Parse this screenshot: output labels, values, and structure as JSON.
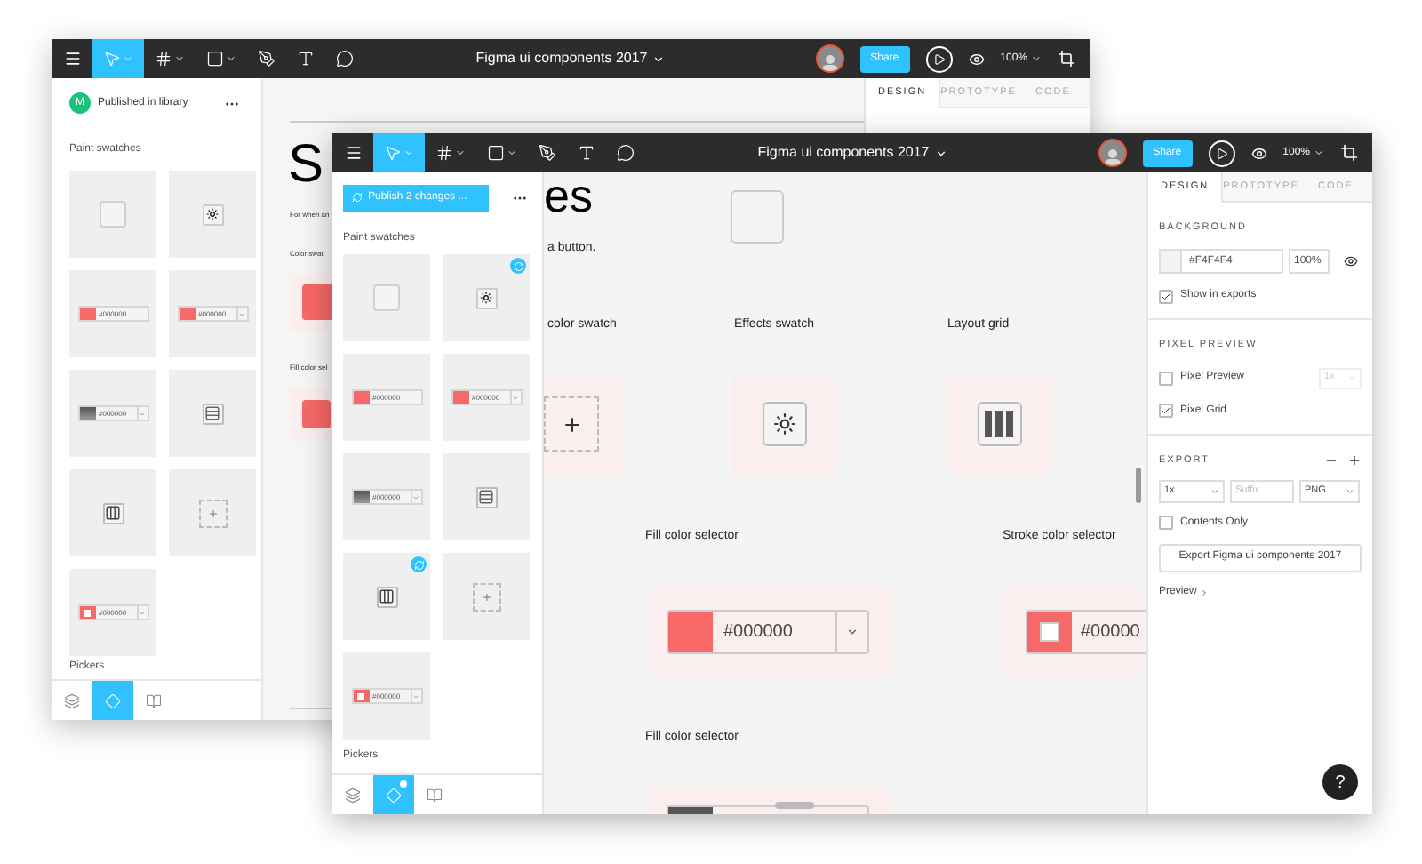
{
  "back_window": {
    "toolbar": {
      "tools": [
        {
          "kind": "move",
          "selected": true
        },
        {
          "kind": "frame",
          "selected": false
        },
        {
          "kind": "shape",
          "selected": false
        },
        {
          "kind": "pen",
          "selected": false
        },
        {
          "kind": "text",
          "selected": false
        },
        {
          "kind": "comment",
          "selected": false
        }
      ],
      "title": "Figma ui components 2017",
      "share": "Share",
      "zoom": "100%"
    },
    "left_panel": {
      "header": {
        "kind": "published",
        "avatar": "M",
        "label": "Published in library"
      },
      "section": "Paint swatches",
      "swatches": [
        {
          "kind": "empty",
          "synced": false
        },
        {
          "kind": "effect",
          "synced": false
        },
        {
          "kind": "color",
          "value": "#000000",
          "synced": false
        },
        {
          "kind": "color-dropdown",
          "value": "#000000",
          "synced": false
        },
        {
          "kind": "gradient-dropdown",
          "value": "#000000",
          "synced": false
        },
        {
          "kind": "rows",
          "synced": false
        },
        {
          "kind": "columns",
          "synced": false
        },
        {
          "kind": "add",
          "synced": false
        },
        {
          "kind": "stroke-dropdown",
          "value": "#000000",
          "synced": false
        }
      ],
      "footer_section": "Pickers",
      "tabs": [
        {
          "kind": "layers",
          "selected": false,
          "notification": false
        },
        {
          "kind": "components",
          "selected": true,
          "notification": false
        },
        {
          "kind": "library",
          "selected": false,
          "notification": false
        }
      ]
    },
    "canvas": {
      "title": "S",
      "note": "For when an",
      "labels": [
        "Color swat",
        "Fill color sel"
      ]
    },
    "right_panel": {
      "tabs": [
        {
          "label": "DESIGN",
          "selected": true
        },
        {
          "label": "PROTOTYPE",
          "selected": false
        },
        {
          "label": "CODE",
          "selected": false
        }
      ]
    }
  },
  "front_window": {
    "toolbar": {
      "tools": [
        {
          "kind": "move",
          "selected": true
        },
        {
          "kind": "frame",
          "selected": false
        },
        {
          "kind": "shape",
          "selected": false
        },
        {
          "kind": "pen",
          "selected": false
        },
        {
          "kind": "text",
          "selected": false
        },
        {
          "kind": "comment",
          "selected": false
        }
      ],
      "title": "Figma ui components 2017",
      "share": "Share",
      "zoom": "100%"
    },
    "left_panel": {
      "header": {
        "kind": "publish",
        "label": "Publish 2 changes ..."
      },
      "section": "Paint swatches",
      "swatches": [
        {
          "kind": "empty",
          "synced": false
        },
        {
          "kind": "effect",
          "synced": true
        },
        {
          "kind": "color",
          "value": "#000000",
          "synced": false
        },
        {
          "kind": "color-dropdown",
          "value": "#000000",
          "synced": false
        },
        {
          "kind": "gradient-dropdown",
          "value": "#000000",
          "synced": false
        },
        {
          "kind": "rows",
          "synced": false
        },
        {
          "kind": "columns",
          "synced": true
        },
        {
          "kind": "add",
          "synced": false
        },
        {
          "kind": "stroke-dropdown",
          "value": "#000000",
          "synced": false
        }
      ],
      "footer_section": "Pickers",
      "tabs": [
        {
          "kind": "layers",
          "selected": false,
          "notification": false
        },
        {
          "kind": "components",
          "selected": true,
          "notification": true
        },
        {
          "kind": "library",
          "selected": false,
          "notification": false
        }
      ]
    },
    "canvas": {
      "title": "es",
      "caption": "a button.",
      "swatch_labels": [
        "color swatch",
        "Effects swatch",
        "Layout grid"
      ],
      "selector_labels": [
        "Fill color selector",
        "Stroke color selector",
        "Fill color selector"
      ],
      "fill_value": "#000000",
      "stroke_value": "#00000"
    },
    "right_panel": {
      "tabs": [
        {
          "label": "DESIGN",
          "selected": true
        },
        {
          "label": "PROTOTYPE",
          "selected": false
        },
        {
          "label": "CODE",
          "selected": false
        }
      ],
      "background": {
        "title": "BACKGROUND",
        "value": "#F4F4F4",
        "opacity": "100%",
        "show_in_exports": {
          "label": "Show in exports",
          "checked": true
        }
      },
      "pixel_preview": {
        "title": "PIXEL PREVIEW",
        "preview": {
          "label": "Pixel Preview",
          "checked": false
        },
        "scale": {
          "value": "1x",
          "disabled": true
        },
        "grid": {
          "label": "Pixel Grid",
          "checked": true
        }
      },
      "export": {
        "title": "EXPORT",
        "scale": "1x",
        "suffix_placeholder": "Suffix",
        "format": "PNG",
        "contents_only": {
          "label": "Contents Only",
          "checked": false
        },
        "button": "Export Figma ui components 2017",
        "preview": "Preview"
      },
      "help": "?"
    }
  }
}
